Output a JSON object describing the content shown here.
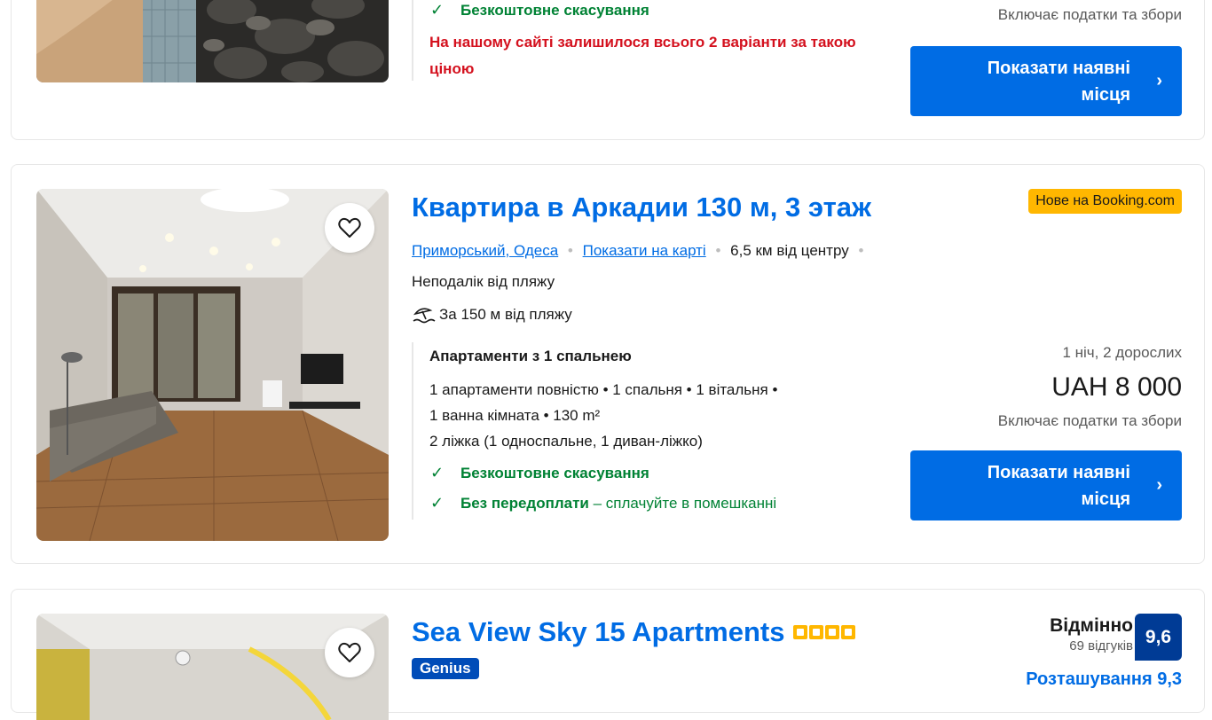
{
  "card1": {
    "free_cancel": "Безкоштовне скасування",
    "scarcity": "На нашому сайті залишилося всього 2 варіанти за такою ціною",
    "taxes": "Включає податки та збори",
    "cta": "Показати наявні місця"
  },
  "card2": {
    "title": "Квартира в Аркадии 130 м, 3 этаж",
    "badge": "Нове на Booking.com",
    "district": "Приморський, Одеса",
    "map_link": "Показати на карті",
    "distance": "6,5 км від центру",
    "near_beach": "Неподалік від пляжу",
    "beach_distance": "За 150 м від пляжу",
    "room_type": "Апартаменти з 1 спальнею",
    "room_details_1": "1 апартаменти повністю • 1 спальня • 1 вітальня •",
    "room_details_2": "1 ванна кімната • 130 m²",
    "beds": "2 ліжка (1 односпальне, 1 диван-ліжко)",
    "free_cancel": "Безкоштовне скасування",
    "no_prepay_bold": "Без передоплати",
    "no_prepay_rest": " – сплачуйте в помешканні",
    "stay": "1 ніч, 2 дорослих",
    "price": "UAH 8 000",
    "taxes": "Включає податки та збори",
    "cta": "Показати наявні місця"
  },
  "card3": {
    "title": "Sea View Sky 15 Apartments",
    "genius": "Genius",
    "rating_word": "Відмінно",
    "reviews": "69 відгуків",
    "score": "9,6",
    "location_partial": "Розташування 9,3",
    "stars": 4
  },
  "colors": {
    "primary": "#006ce4",
    "green": "#008234",
    "red": "#d4111e",
    "badge": "#ffb700",
    "score_bg": "#003b95"
  }
}
